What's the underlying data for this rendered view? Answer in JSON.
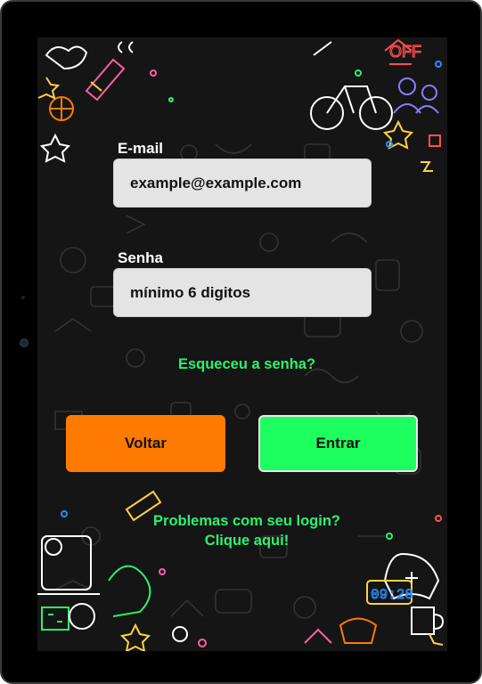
{
  "login": {
    "email_label": "E-mail",
    "email_placeholder": "example@example.com",
    "password_label": "Senha",
    "password_placeholder": "mínimo 6 digitos",
    "forgot_password": "Esqueceu a senha?",
    "back_button": "Voltar",
    "enter_button": "Entrar",
    "login_problems_line1": "Problemas com seu login?",
    "login_problems_line2": "Clique aqui!"
  },
  "theme": {
    "background": "#151515",
    "accent_green": "#2cf26e",
    "back_button_color": "#ff7a00",
    "enter_button_color": "#1dff5e",
    "input_background": "#e4e4e4"
  },
  "decorations": {
    "background_pattern": "colorful-doodle-pattern"
  }
}
